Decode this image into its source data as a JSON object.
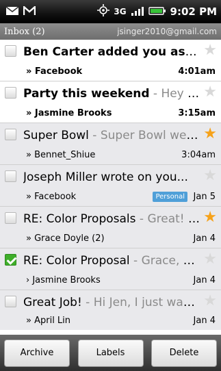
{
  "status_bar": {
    "time": "9:02 PM",
    "network": "3G",
    "icons": [
      "email-icon",
      "gmail-icon",
      "gps-icon",
      "signal-icon",
      "battery-icon"
    ]
  },
  "header": {
    "title": "Inbox (2)",
    "account": "jsinger2010@gmail.com"
  },
  "messages": [
    {
      "subject": "Ben Carter added you as ...",
      "snippet": "",
      "sender": "» Facebook",
      "time": "4:01am",
      "unread": true,
      "starred": false,
      "checked": false
    },
    {
      "subject": "Party this weekend",
      "snippet": " - Hey Je...",
      "sender": "» Jasmine Brooks",
      "time": "3:15am",
      "unread": true,
      "starred": false,
      "checked": false
    },
    {
      "subject": "Super Bowl",
      "snippet": " - Super Bowl wee...",
      "sender": "» Bennet_Shiue",
      "time": "3:04am",
      "unread": false,
      "starred": true,
      "checked": false
    },
    {
      "subject": "Joseph Miller wrote on you...",
      "snippet": "",
      "sender": "» Facebook",
      "time": "Jan 5",
      "label": "Personal",
      "unread": false,
      "starred": false,
      "checked": false
    },
    {
      "subject": "RE: Color Proposals",
      "snippet": " - Great! L...",
      "sender": "» Grace Doyle (2)",
      "time": "Jan 4",
      "unread": false,
      "starred": true,
      "checked": false
    },
    {
      "subject": "RE: Color Proposal",
      "snippet": " - Grace, c...",
      "sender": "› Jasmine Brooks",
      "time": "Jan 4",
      "unread": false,
      "starred": false,
      "checked": true
    },
    {
      "subject": "Great Job!",
      "snippet": " - Hi Jen, I just want...",
      "sender": "» April Lin",
      "time": "Jan 4",
      "unread": false,
      "starred": false,
      "checked": false
    }
  ],
  "buttons": {
    "archive": "Archive",
    "labels": "Labels",
    "delete": "Delete"
  },
  "colors": {
    "star_on": "#f6a21a",
    "label_bg": "#4f9fd8",
    "check_on": "#3fae2a"
  }
}
